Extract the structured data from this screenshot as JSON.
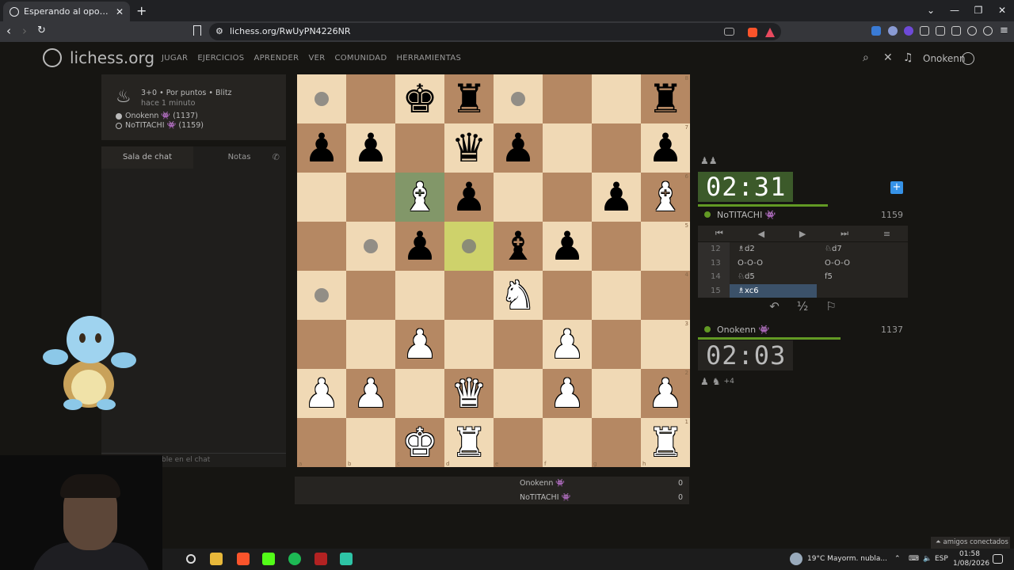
{
  "browser": {
    "tab_title": "Esperando al oponente - Jugar",
    "tab_close": "✕",
    "new_tab": "+",
    "url": "lichess.org/RwUyPN4226NR"
  },
  "header": {
    "logo": "lichess.org",
    "nav": [
      "JUGAR",
      "EJERCICIOS",
      "APRENDER",
      "VER",
      "COMUNIDAD",
      "HERRAMIENTAS"
    ],
    "username": "Onokenn"
  },
  "game_info": {
    "line1": "3+0 • Por puntos • Blitz",
    "line2": "hace 1 minuto",
    "player_white": "Onokenn 👾 (1137)",
    "player_black": "NoTITACHI 👾 (1159)"
  },
  "chat": {
    "tab_chat": "Sala de chat",
    "tab_notes": "Notas",
    "input_hint": "ble en el chat"
  },
  "board": {
    "rows": [
      [
        "",
        "",
        "bK",
        "bR",
        "",
        "",
        "",
        "bR"
      ],
      [
        "bP",
        "bP",
        "",
        "bQ",
        "bP",
        "",
        "",
        "bP"
      ],
      [
        "",
        "",
        "wB",
        "bP",
        "",
        "",
        "bP",
        "wB"
      ],
      [
        "",
        "",
        "bP",
        "",
        "bB",
        "bP",
        "",
        ""
      ],
      [
        "",
        "",
        "",
        "",
        "wN",
        "",
        "",
        ""
      ],
      [
        "",
        "",
        "wP",
        "",
        "",
        "wP",
        "",
        ""
      ],
      [
        "wP",
        "wP",
        "",
        "wQ",
        "",
        "wP",
        "",
        "wP"
      ],
      [
        "",
        "",
        "wK",
        "wR",
        "",
        "",
        "",
        "wR"
      ]
    ],
    "dots": [
      [
        0,
        0
      ],
      [
        0,
        4
      ],
      [
        3,
        1
      ],
      [
        3,
        3
      ],
      [
        4,
        0
      ]
    ],
    "highlights": [
      {
        "r": 2,
        "c": 2,
        "kind": "from"
      },
      {
        "r": 3,
        "c": 3,
        "kind": "to"
      }
    ],
    "files": [
      "a",
      "b",
      "c",
      "d",
      "e",
      "f",
      "g",
      "h"
    ],
    "ranks": [
      "8",
      "7",
      "6",
      "5",
      "4",
      "3",
      "2",
      "1"
    ]
  },
  "opponent": {
    "clock": "02:31",
    "name": "NoTITACHI 👾",
    "rating": "1159",
    "time_fraction": 0.62
  },
  "self": {
    "clock": "02:03",
    "name": "Onokenn 👾",
    "rating": "1137",
    "time_fraction": 0.68,
    "material": "+4"
  },
  "moves": [
    {
      "no": "12",
      "w": "♗d2",
      "b": "♘d7"
    },
    {
      "no": "13",
      "w": "O-O-O",
      "b": "O-O-O"
    },
    {
      "no": "14",
      "w": "♘d5",
      "b": "f5"
    },
    {
      "no": "15",
      "w": "♗xc6",
      "b": ""
    }
  ],
  "move_controls": [
    "⏮",
    "◀",
    "▶",
    "⏭",
    "≡"
  ],
  "actions": [
    "↶",
    "½",
    "⚐"
  ],
  "score": [
    {
      "name": "Onokenn 👾",
      "pts": "0"
    },
    {
      "name": "NoTITACHI 👾",
      "pts": "0"
    }
  ],
  "taskbar": {
    "weather": "19°C  Mayorm. nubla...",
    "lang": "ESP",
    "time": "01:58",
    "date": "1/08/2026",
    "friends": "⏶ amigos conectados"
  }
}
